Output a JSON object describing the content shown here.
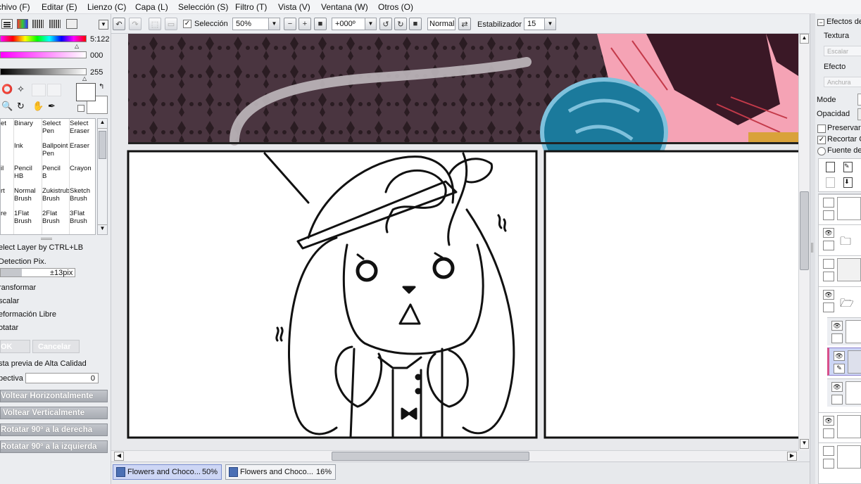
{
  "menu": [
    "chivo (F)",
    "Editar (E)",
    "Lienzo (C)",
    "Capa (L)",
    "Selección (S)",
    "Filtro (T)",
    "Vista (V)",
    "Ventana (W)",
    "Otros (O)"
  ],
  "toolbar": {
    "selection_label": "Selección",
    "zoom": "50%",
    "rotation": "+000º",
    "mode": "Normal",
    "stabilizer_label": "Estabilizador",
    "stabilizer_value": "15"
  },
  "color": {
    "hue_value": "5:122",
    "sat_value": "000",
    "val_value": "255"
  },
  "brushes": [
    [
      "et",
      "Binary",
      "Select\nPen",
      "Select\nEraser"
    ],
    [
      "",
      "Ink",
      "Ballpoint\nPen",
      "Eraser"
    ],
    [
      "il",
      "Pencil\nHB",
      "Pencil\nB",
      "Crayon"
    ],
    [
      "rt",
      "Normal\nBrush",
      "Zukistrub\nBrush",
      "Sketch\nBrush"
    ],
    [
      "re",
      "1Flat\nBrush",
      "2Flat\nBrush",
      "3Flat\nBrush"
    ]
  ],
  "left_options": {
    "select_layer": "elect Layer by CTRL+LB",
    "detection": "Detection Pix.",
    "detection_value": "±13pix",
    "transform": "ransformar",
    "scale": "scalar",
    "free_deform": "eformación Libre",
    "rotate": "otatar",
    "ok": "OK",
    "cancel": "Cancelar",
    "hq_preview": "sta previa de Alta Calidad",
    "perspective": "pectiva",
    "perspective_value": "0",
    "flip_h": "Voltear Horizontalmente",
    "flip_v": "Voltear Verticalmente",
    "rotate_right": "Rotatar 90º a la derecha",
    "rotate_left": "Rotatar 90º a la izquierda"
  },
  "right_panel": {
    "title": "Efectos de",
    "texture": "Textura",
    "texture_value": "Escalar",
    "effect": "Efecto",
    "effect_value": "Anchura",
    "mode": "Mode",
    "opacity": "Opacidad",
    "preserve": "Preservar",
    "clip": "Recortar C",
    "source": "Fuente de"
  },
  "documents": [
    {
      "name": "Flowers and Choco...",
      "zoom": "50%",
      "active": true
    },
    {
      "name": "Flowers and Choco...",
      "zoom": "16%",
      "active": false
    }
  ],
  "colors": {
    "panel_bg": "#ebedf0",
    "active_tab": "#cdd6f5",
    "canvas_pattern": "#4a3540",
    "character_pink": "#f5a3b5",
    "character_dark": "#3a1826",
    "blue_ball": "#1b7a9c"
  }
}
